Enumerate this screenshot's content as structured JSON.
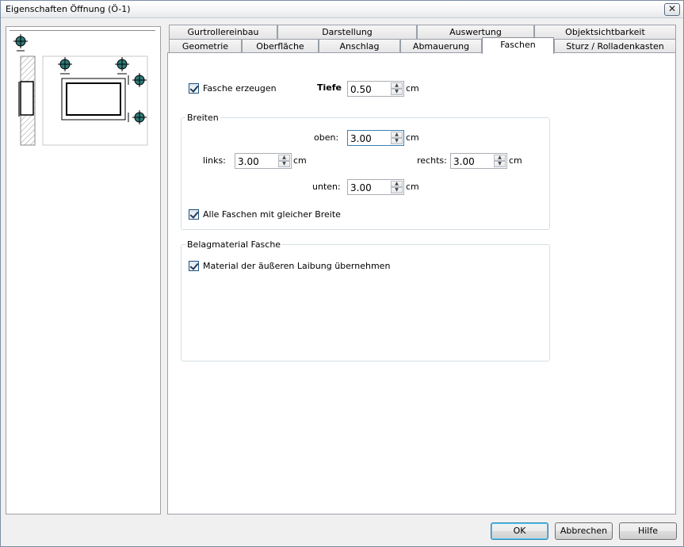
{
  "window": {
    "title": "Eigenschaften Öffnung (Ö-1)",
    "close_glyph": "✕"
  },
  "tabs": {
    "row1": [
      {
        "label": "Gurtrollereinbau"
      },
      {
        "label": "Darstellung"
      },
      {
        "label": "Auswertung"
      },
      {
        "label": "Objektsichtbarkeit"
      }
    ],
    "row2": [
      {
        "label": "Geometrie"
      },
      {
        "label": "Oberfläche"
      },
      {
        "label": "Anschlag"
      },
      {
        "label": "Abmauerung"
      },
      {
        "label": "Faschen"
      },
      {
        "label": "Sturz / Rolladenkasten"
      }
    ],
    "active": "Faschen"
  },
  "faschen": {
    "create_label": "Fasche erzeugen",
    "create_checked": true,
    "tiefe_label": "Tiefe",
    "tiefe_value": "0.50",
    "unit": "cm"
  },
  "breiten": {
    "legend": "Breiten",
    "oben_label": "oben:",
    "oben_value": "3.00",
    "links_label": "links:",
    "links_value": "3.00",
    "rechts_label": "rechts:",
    "rechts_value": "3.00",
    "unten_label": "unten:",
    "unten_value": "3.00",
    "unit": "cm",
    "same_width_label": "Alle Faschen mit gleicher Breite",
    "same_width_checked": true
  },
  "belag": {
    "legend": "Belagmaterial Fasche",
    "material_label": "Material der äußeren Laibung übernehmen",
    "material_checked": true
  },
  "footer": {
    "ok_label": "OK",
    "cancel_label": "Abbrechen",
    "help_label": "Hilfe"
  },
  "colors": {
    "marker_fill": "#2e7d7a",
    "accent_border": "#3c7fb1"
  }
}
